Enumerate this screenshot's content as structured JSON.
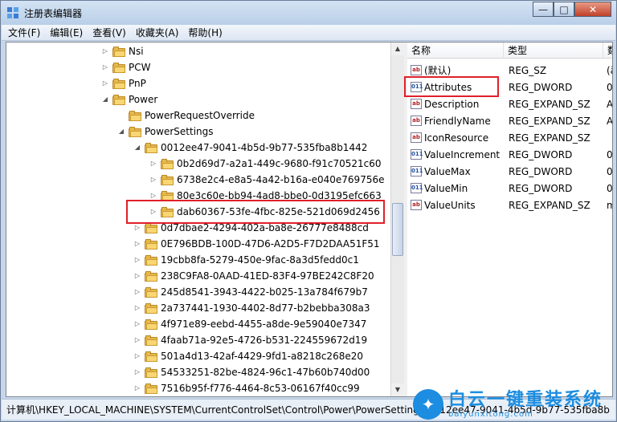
{
  "window": {
    "title": "注册表编辑器",
    "min_label": "—",
    "max_label": "□",
    "close_label": "✕"
  },
  "menu": [
    "文件(F)",
    "编辑(E)",
    "查看(V)",
    "收藏夹(A)",
    "帮助(H)"
  ],
  "tree": {
    "items": [
      {
        "label": "Nsi",
        "expander": "▷"
      },
      {
        "label": "PCW",
        "expander": "▷"
      },
      {
        "label": "PnP",
        "expander": "▷"
      },
      {
        "label": "Power",
        "expander": "◢"
      },
      {
        "label": "PowerRequestOverride",
        "expander": ""
      },
      {
        "label": "PowerSettings",
        "expander": "◢"
      },
      {
        "label": "0012ee47-9041-4b5d-9b77-535fba8b1442",
        "expander": "◢"
      },
      {
        "label": "0b2d69d7-a2a1-449c-9680-f91c70521c60",
        "expander": "▷"
      },
      {
        "label": "6738e2c4-e8a5-4a42-b16a-e040e769756e",
        "expander": "▷"
      },
      {
        "label": "80e3c60e-bb94-4ad8-bbe0-0d3195efc663",
        "expander": "▷"
      },
      {
        "label": "dab60367-53fe-4fbc-825e-521d069d2456",
        "expander": "▷"
      },
      {
        "label": "0d7dbae2-4294-402a-ba8e-26777e8488cd",
        "expander": "▷"
      },
      {
        "label": "0E796BDB-100D-47D6-A2D5-F7D2DAA51F51",
        "expander": "▷"
      },
      {
        "label": "19cbb8fa-5279-450e-9fac-8a3d5fedd0c1",
        "expander": "▷"
      },
      {
        "label": "238C9FA8-0AAD-41ED-83F4-97BE242C8F20",
        "expander": "▷"
      },
      {
        "label": "245d8541-3943-4422-b025-13a784f679b7",
        "expander": "▷"
      },
      {
        "label": "2a737441-1930-4402-8d77-b2bebba308a3",
        "expander": "▷"
      },
      {
        "label": "4f971e89-eebd-4455-a8de-9e59040e7347",
        "expander": "▷"
      },
      {
        "label": "4faab71a-92e5-4726-b531-224559672d19",
        "expander": "▷"
      },
      {
        "label": "501a4d13-42af-4429-9fd1-a8218c268e20",
        "expander": "▷"
      },
      {
        "label": "54533251-82be-4824-96c1-47b60b740d00",
        "expander": "▷"
      },
      {
        "label": "7516b95f-f776-4464-8c53-06167f40cc99",
        "expander": "▷"
      }
    ]
  },
  "values": {
    "headers": {
      "name": "名称",
      "type": "类型",
      "data": "数"
    },
    "rows": [
      {
        "icon": "ab",
        "name": "(默认)",
        "type": "REG_SZ",
        "data": "(ä"
      },
      {
        "icon": "011",
        "name": "Attributes",
        "type": "REG_DWORD",
        "data": "0"
      },
      {
        "icon": "ab",
        "name": "Description",
        "type": "REG_EXPAND_SZ",
        "data": "A"
      },
      {
        "icon": "ab",
        "name": "FriendlyName",
        "type": "REG_EXPAND_SZ",
        "data": "A"
      },
      {
        "icon": "ab",
        "name": "IconResource",
        "type": "REG_EXPAND_SZ",
        "data": ""
      },
      {
        "icon": "011",
        "name": "ValueIncrement",
        "type": "REG_DWORD",
        "data": "0"
      },
      {
        "icon": "011",
        "name": "ValueMax",
        "type": "REG_DWORD",
        "data": "0"
      },
      {
        "icon": "011",
        "name": "ValueMin",
        "type": "REG_DWORD",
        "data": "0"
      },
      {
        "icon": "ab",
        "name": "ValueUnits",
        "type": "REG_EXPAND_SZ",
        "data": "m"
      }
    ]
  },
  "status": {
    "path": "计算机\\HKEY_LOCAL_MACHINE\\SYSTEM\\CurrentControlSet\\Control\\Power\\PowerSettings\\0012ee47-9041-4b5d-9b77-535fba8b"
  },
  "watermark": {
    "main": "白云一键重装系统",
    "sub": "baiyunxitong.com"
  },
  "colors": {
    "highlight": "#e0202a",
    "folder": "#e8b84a",
    "watermark": "#1c8de0"
  }
}
